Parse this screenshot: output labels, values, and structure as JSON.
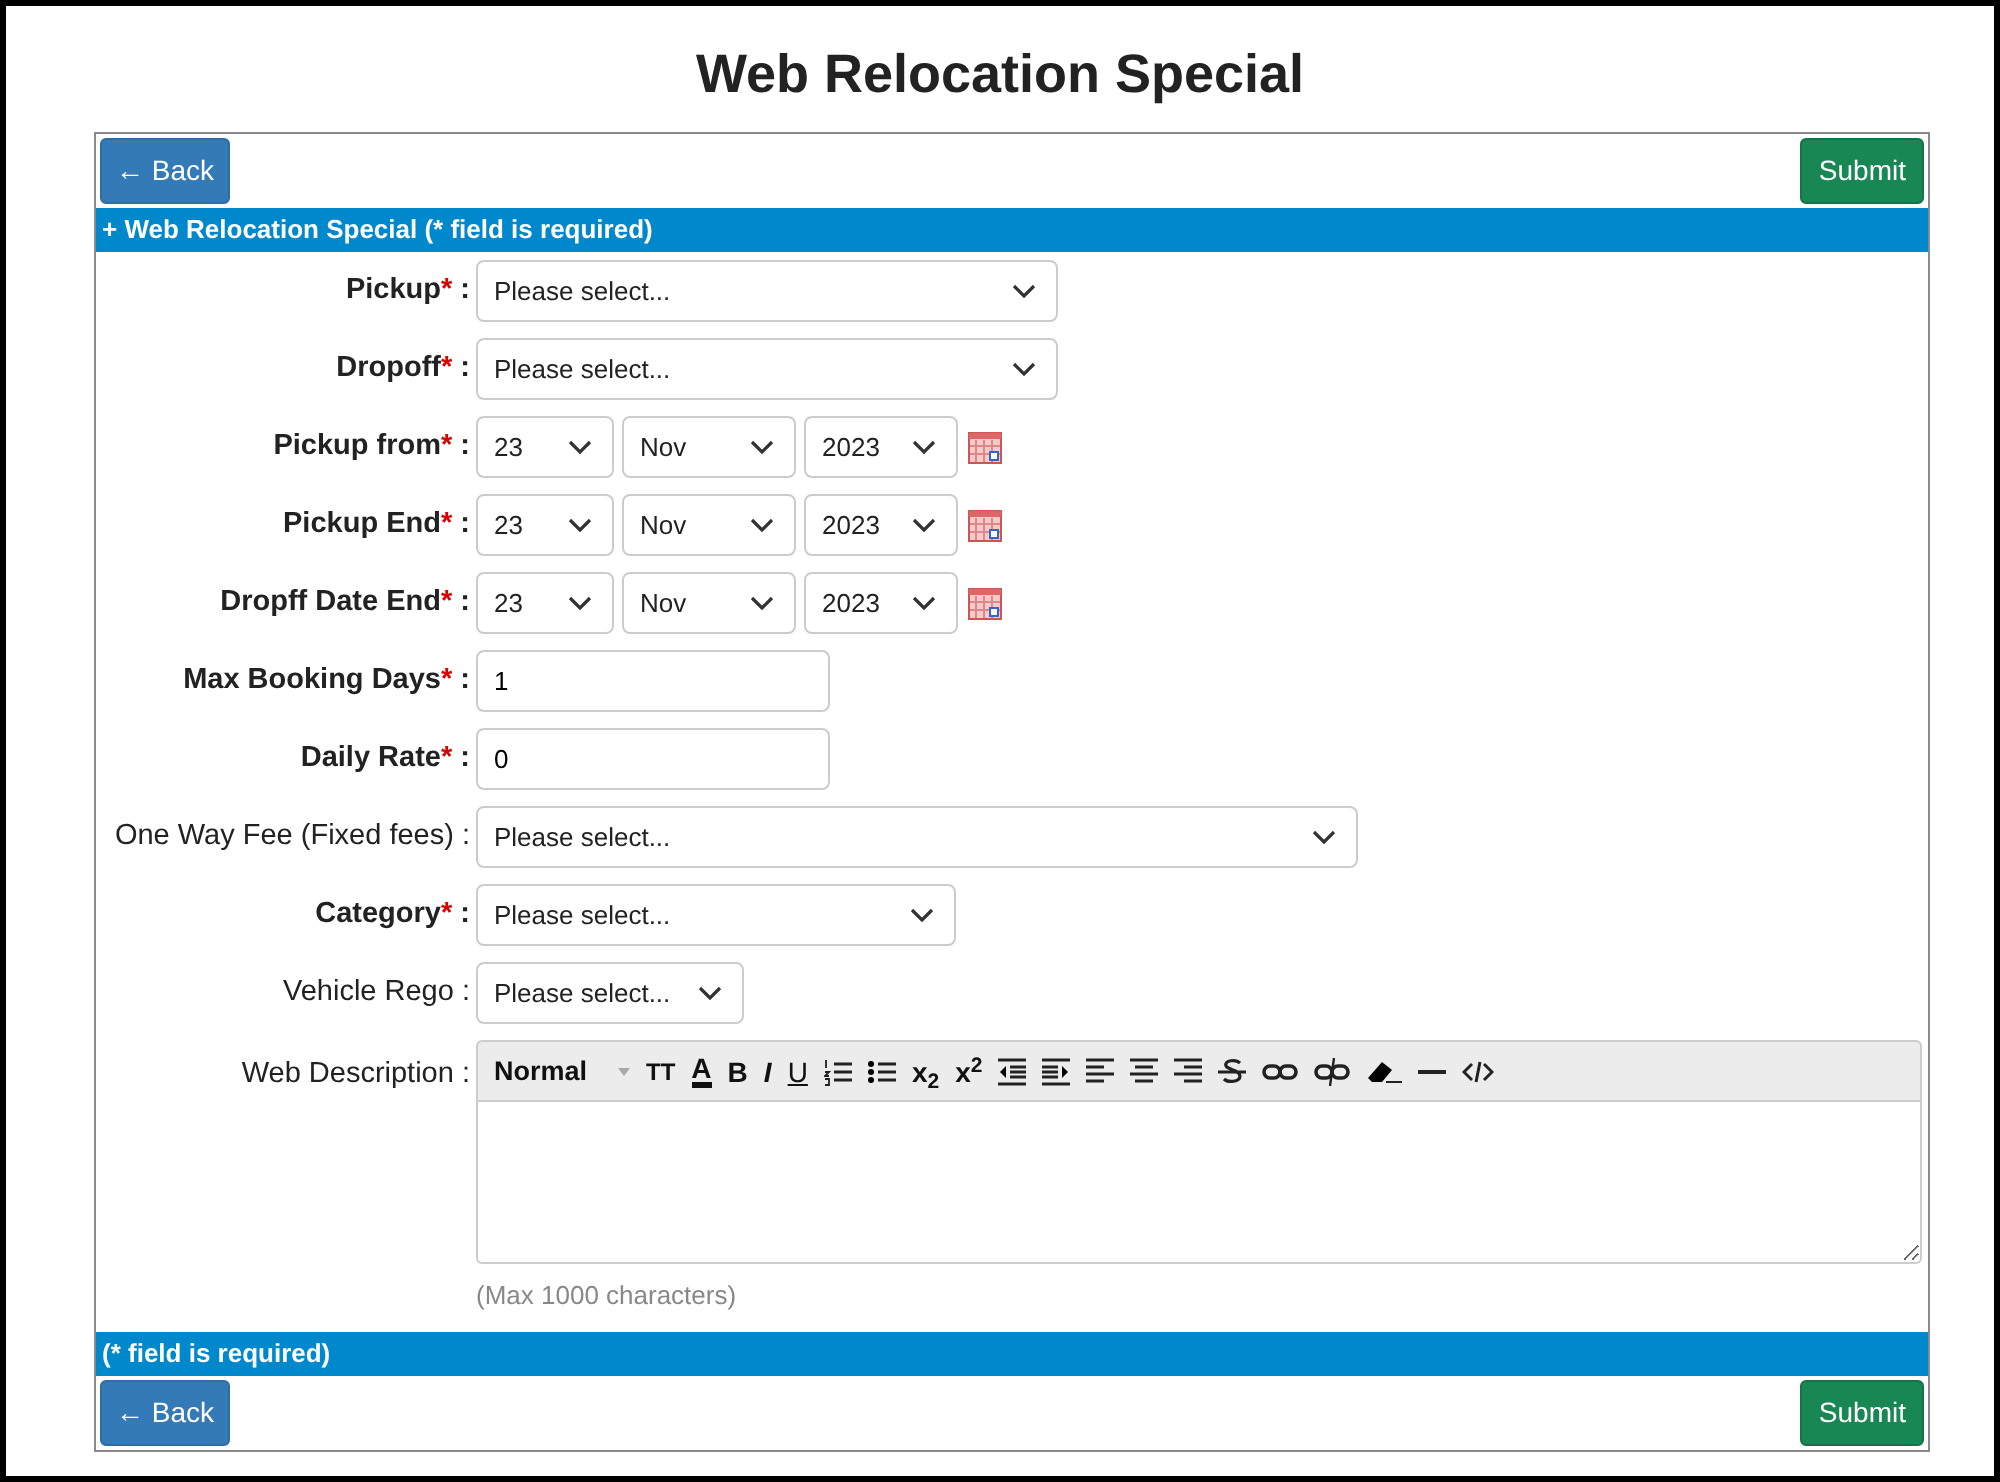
{
  "title": "Web Relocation Special",
  "top_buttons": {
    "back": "← Back",
    "submit": "Submit"
  },
  "section_header": {
    "icon": "+",
    "text": "Web Relocation Special (* field is required)"
  },
  "required_mark": "*",
  "separator": ":",
  "fields": [
    {
      "kind": "select",
      "label": "Pickup",
      "required": true,
      "value": "Please select..."
    },
    {
      "kind": "select",
      "label": "Dropoff",
      "required": true,
      "value": "Please select..."
    },
    {
      "kind": "date",
      "label": "Pickup from",
      "required": true,
      "day": "23",
      "month": "Nov",
      "year": "2023"
    },
    {
      "kind": "date",
      "label": "Pickup End",
      "required": true,
      "day": "23",
      "month": "Nov",
      "year": "2023"
    },
    {
      "kind": "date",
      "label": "Dropff Date End",
      "required": true,
      "day": "23",
      "month": "Nov",
      "year": "2023"
    },
    {
      "kind": "text",
      "label": "Max Booking Days",
      "required": true,
      "value": "1"
    },
    {
      "kind": "text",
      "label": "Daily Rate",
      "required": true,
      "value": "0"
    },
    {
      "kind": "select",
      "label": "One Way Fee (Fixed fees)",
      "required": false,
      "value": "Please select..."
    },
    {
      "kind": "select",
      "label": "Category",
      "required": true,
      "value": "Please select..."
    },
    {
      "kind": "select",
      "label": "Vehicle Rego",
      "required": false,
      "value": "Please select..."
    },
    {
      "kind": "editor",
      "label": "Web Description",
      "required": false,
      "format": "Normal",
      "letters": [
        "TT",
        "A",
        "B",
        "I",
        "U",
        "x$_{2}$",
        "x$^{2}$"
      ],
      "hint": "(Max 1000 characters)"
    }
  ],
  "footer_header": {
    "text": "(* field is required)"
  },
  "bottom_buttons": {
    "back": "← Back",
    "submit": "Submit"
  }
}
